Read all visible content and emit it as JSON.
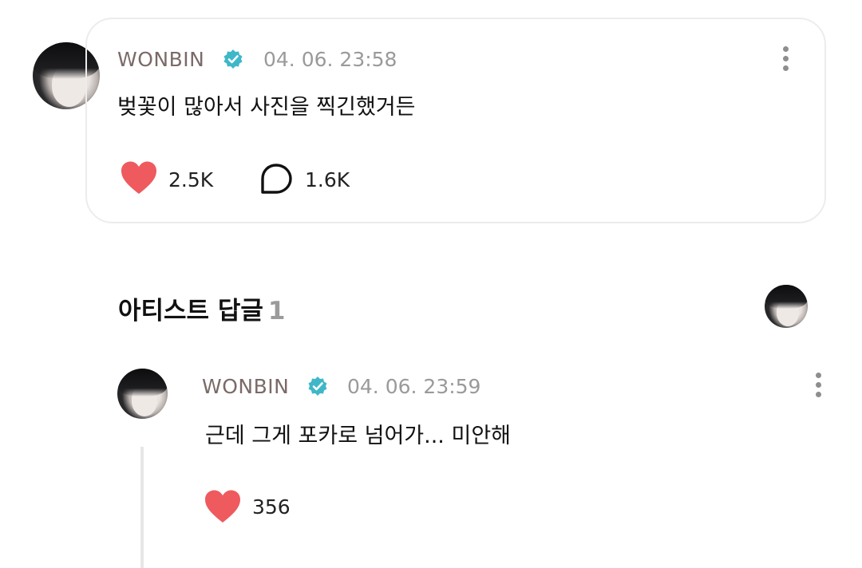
{
  "post": {
    "author": "WONBIN",
    "timestamp": "04. 06. 23:58",
    "text": "벚꽃이 많아서 사진을 찍긴했거든",
    "likes": "2.5K",
    "comments": "1.6K"
  },
  "replies_section": {
    "title": "아티스트 답글",
    "count": "1"
  },
  "reply": {
    "author": "WONBIN",
    "timestamp": "04. 06. 23:59",
    "text": "근데 그게 포카로 넘어가... 미안해",
    "likes": "356"
  },
  "colors": {
    "heart": "#ee5a5e",
    "verified": "#3fb7c9",
    "name": "#7a6a68",
    "timestamp": "#9a9a9a"
  },
  "icons": {
    "more": "kebab-icon",
    "like": "heart-icon",
    "comment": "speech-bubble-icon",
    "verified": "verified-badge-icon"
  }
}
